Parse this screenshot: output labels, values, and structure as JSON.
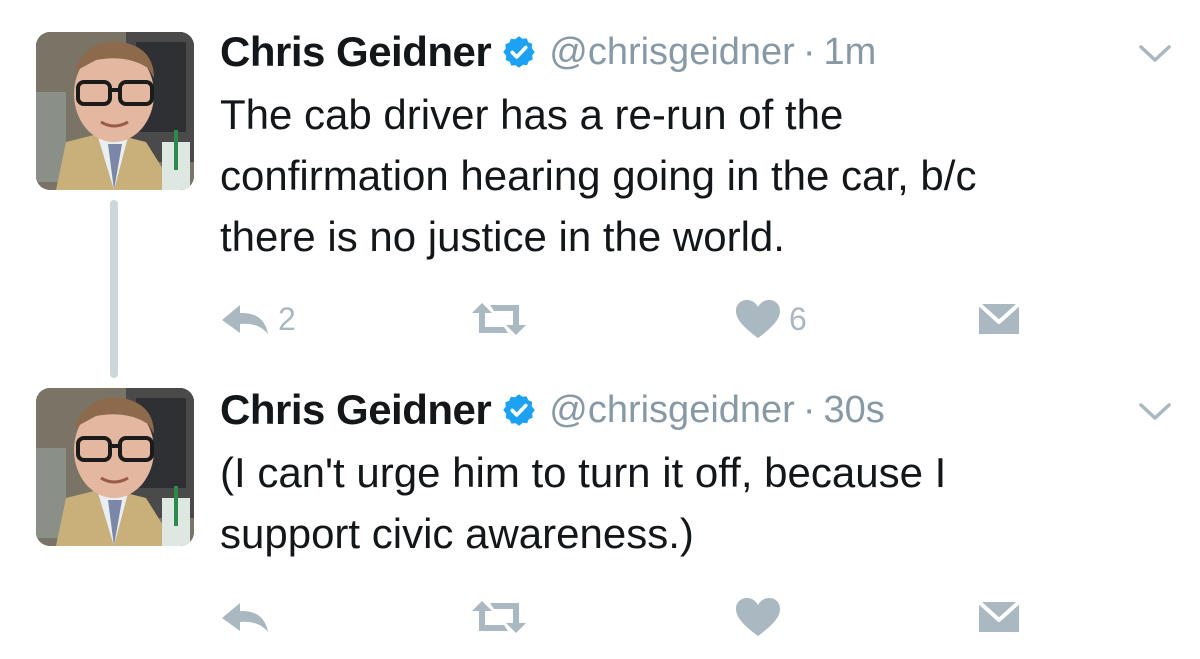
{
  "tweets": [
    {
      "name": "Chris Geidner",
      "handle": "@chrisgeidner",
      "separator": "·",
      "time": "1m",
      "text_lines": [
        "The cab driver has a re-run of the",
        "confirmation hearing going in the car, b/c",
        "there is no justice in the world."
      ],
      "replies": "2",
      "retweets": "",
      "likes": "6"
    },
    {
      "name": "Chris Geidner",
      "handle": "@chrisgeidner",
      "separator": "·",
      "time": "30s",
      "text_lines": [
        "(I can't urge him to turn it off, because I",
        "support civic awareness.)"
      ],
      "replies": "",
      "retweets": "",
      "likes": ""
    }
  ],
  "icons": {
    "verified": "verified-badge-icon",
    "caret": "chevron-down-icon",
    "reply": "reply-icon",
    "retweet": "retweet-icon",
    "like": "heart-icon",
    "dm": "envelope-icon"
  },
  "colors": {
    "verified": "#1da1f2",
    "muted": "#8899a6",
    "action_icon": "#aab8c2",
    "thread_line": "#ccd6dd"
  }
}
